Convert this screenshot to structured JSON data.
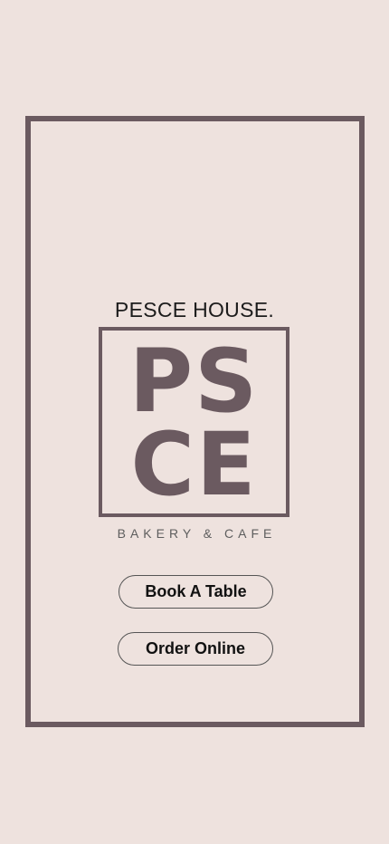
{
  "brand": {
    "name": "PESCE HOUSE.",
    "logo_line1": "PS",
    "logo_line2": "CE",
    "tagline": "BAKERY & CAFE"
  },
  "actions": {
    "book_label": "Book A Table",
    "order_label": "Order Online"
  },
  "colors": {
    "background": "#eee2de",
    "accent": "#6b5a60"
  }
}
